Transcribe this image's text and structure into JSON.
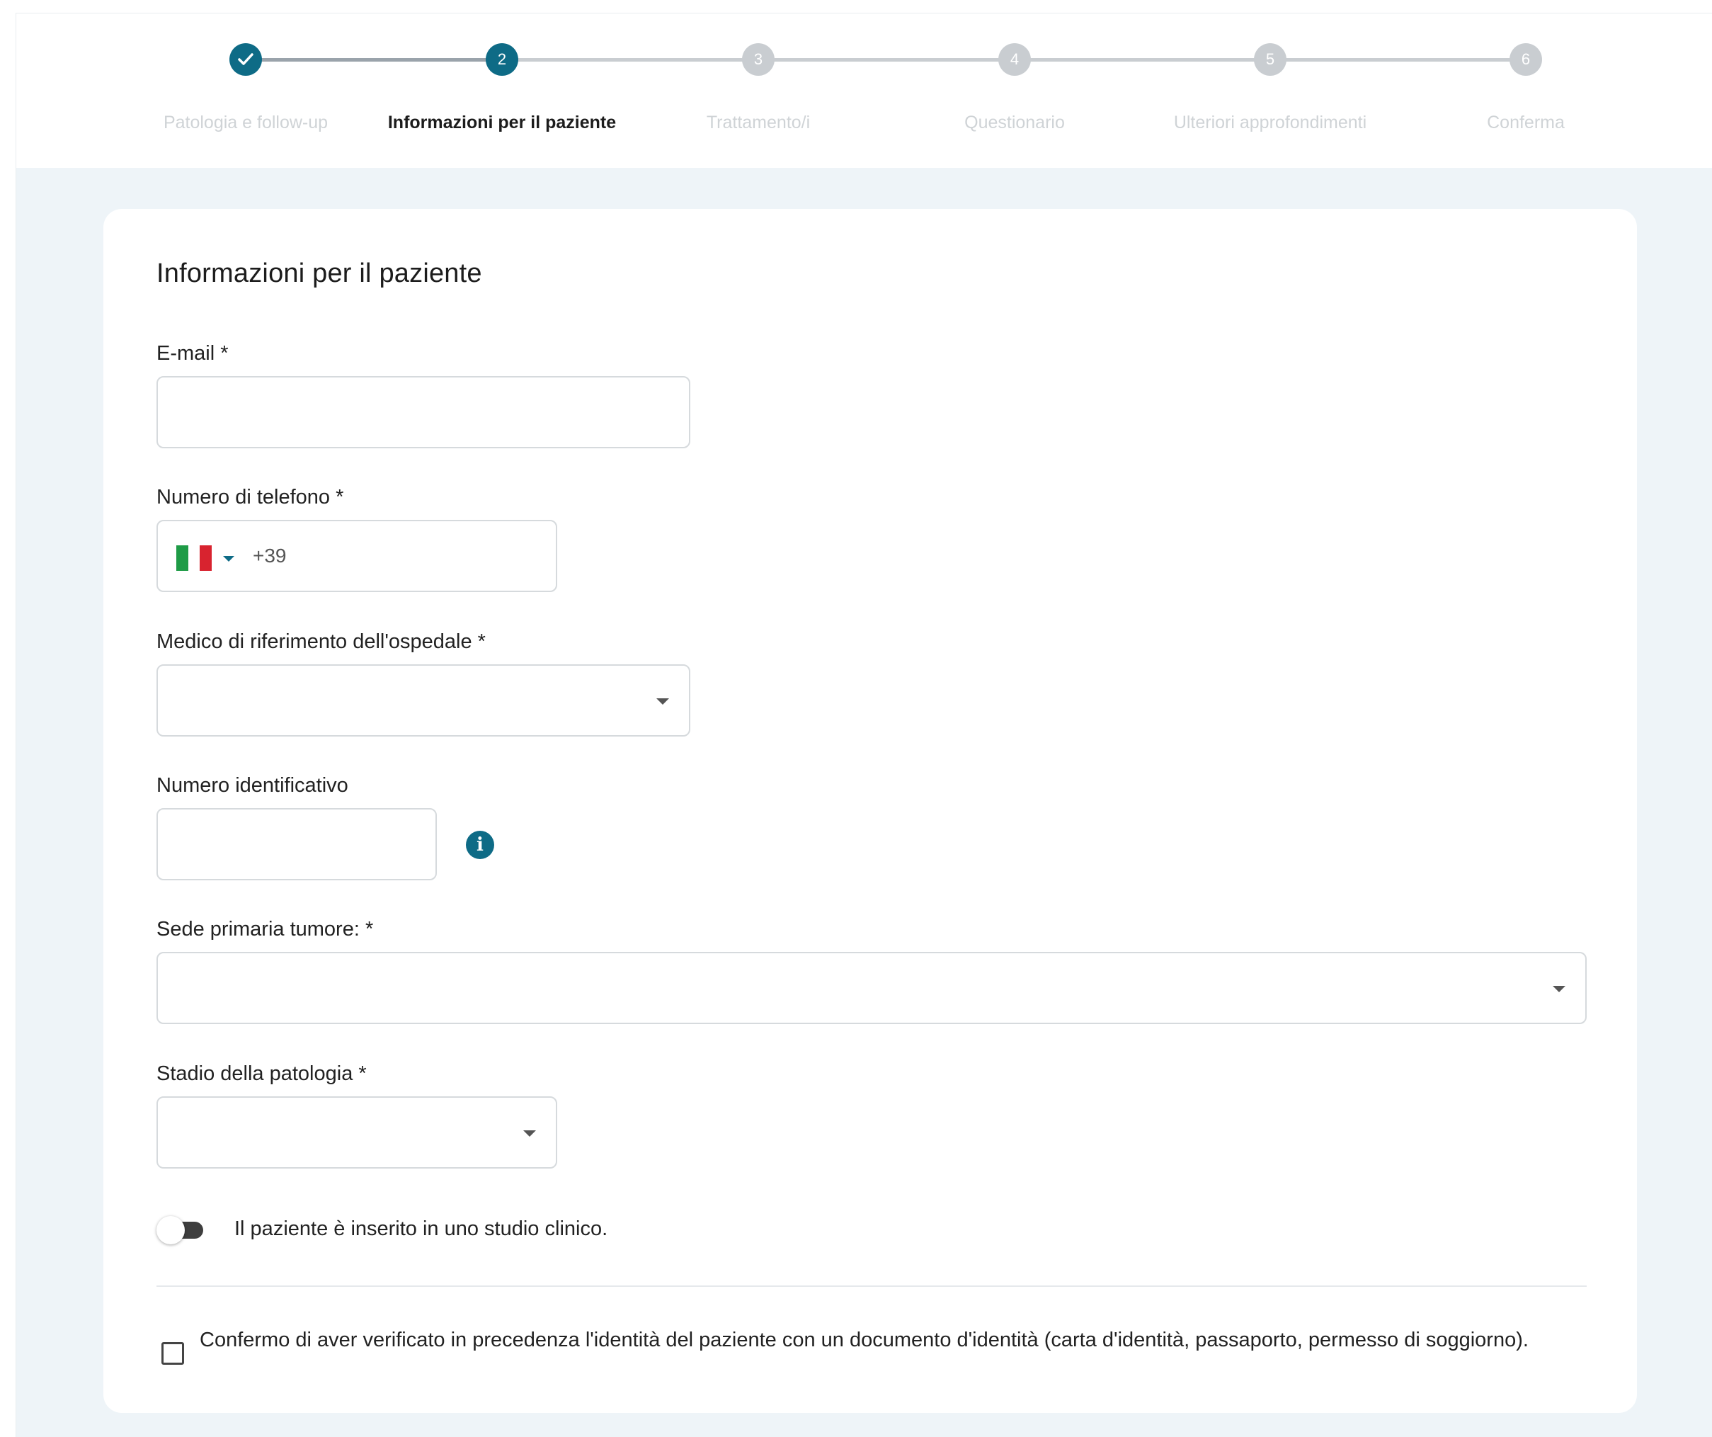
{
  "stepper": {
    "steps": [
      {
        "number": "1",
        "label": "Patologia e follow-up",
        "state": "done"
      },
      {
        "number": "2",
        "label": "Informazioni per il paziente",
        "state": "active"
      },
      {
        "number": "3",
        "label": "Trattamento/i",
        "state": "pending"
      },
      {
        "number": "4",
        "label": "Questionario",
        "state": "pending"
      },
      {
        "number": "5",
        "label": "Ulteriori approfondimenti",
        "state": "pending"
      },
      {
        "number": "6",
        "label": "Conferma",
        "state": "pending"
      }
    ]
  },
  "form": {
    "title": "Informazioni per il paziente",
    "email": {
      "label": "E-mail *",
      "value": ""
    },
    "phone": {
      "label": "Numero di telefono *",
      "country_flag": "italy-flag-icon",
      "prefix": "+39",
      "value": ""
    },
    "doctor": {
      "label": "Medico di riferimento dell'ospedale *",
      "value": ""
    },
    "id_number": {
      "label": "Numero identificativo",
      "value": ""
    },
    "tumor_site": {
      "label": "Sede primaria tumore: *",
      "value": ""
    },
    "stage": {
      "label": "Stadio della patologia *",
      "value": ""
    },
    "clinical_study_toggle": {
      "label": "Il paziente è inserito in uno studio clinico.",
      "on": false
    },
    "identity_confirm": {
      "label": "Confermo di aver verificato in precedenza l'identità del paziente con un documento d'identità (carta d'identità, passaporto, permesso di soggiorno).",
      "checked": false
    }
  },
  "colors": {
    "accent": "#0e6b86",
    "background": "#eef4f8",
    "inactive_step": "#c9cdd1"
  }
}
